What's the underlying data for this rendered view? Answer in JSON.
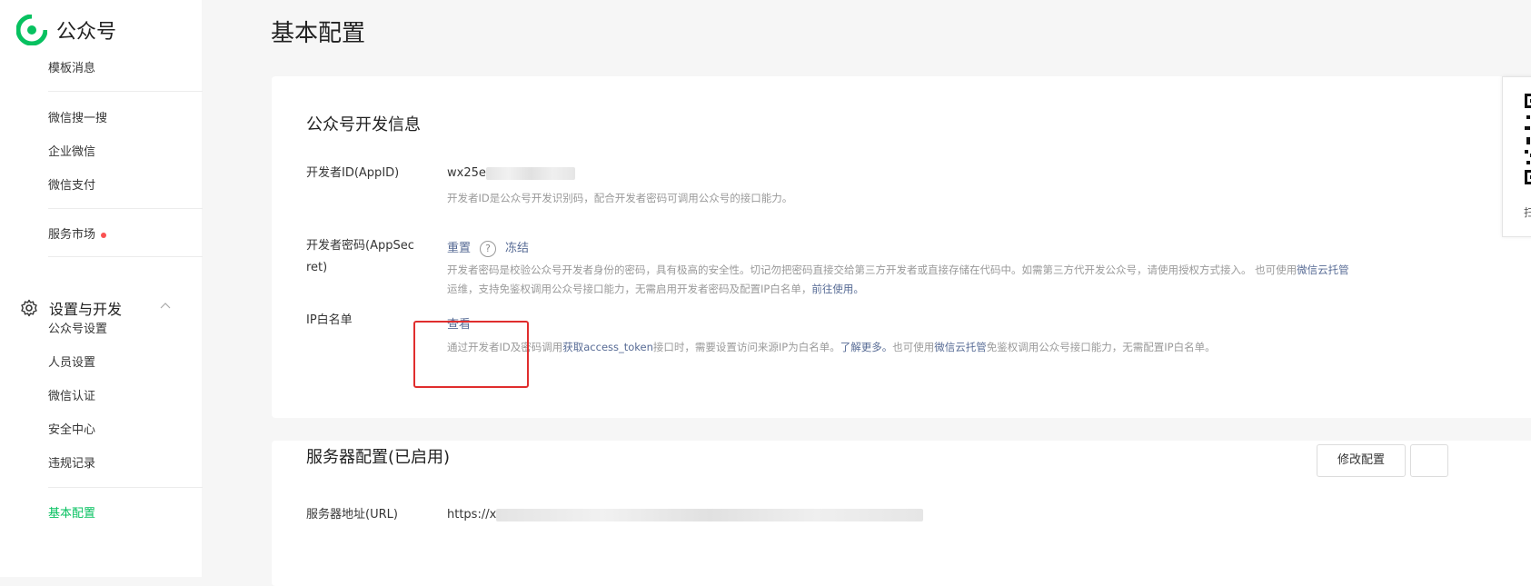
{
  "app": {
    "name": "公众号"
  },
  "sidebar": {
    "items_top": [
      {
        "label": "模板消息"
      },
      {
        "label": "微信搜一搜"
      },
      {
        "label": "企业微信"
      },
      {
        "label": "微信支付"
      },
      {
        "label": "服务市场"
      }
    ],
    "section": {
      "label": "设置与开发"
    },
    "items_settings": [
      {
        "label": "公众号设置"
      },
      {
        "label": "人员设置"
      },
      {
        "label": "微信认证"
      },
      {
        "label": "安全中心"
      },
      {
        "label": "违规记录"
      }
    ],
    "active_item": {
      "label": "基本配置"
    }
  },
  "page": {
    "title": "基本配置"
  },
  "dev_info": {
    "title": "公众号开发信息",
    "appid": {
      "label": "开发者ID(AppID)",
      "value": "wx25e",
      "desc": "开发者ID是公众号开发识别码，配合开发者密码可调用公众号的接口能力。"
    },
    "secret": {
      "label_line1": "开发者密码(AppSec",
      "label_line2": "ret)",
      "reset": "重置",
      "help": "?",
      "freeze": "冻结",
      "desc1": "开发者密码是校验公众号开发者身份的密码，具有极高的安全性。切记勿把密码直接交给第三方开发者或直接存储在代码中。如需第三方代开发公众号，请使用授权方式接入。 也可使用",
      "desc1_link": "微信云托管",
      "desc2": "运维，支持免鉴权调用公众号接口能力，无需启用开发者密码及配置IP白名单，",
      "desc2_link": "前往使用。"
    },
    "ip": {
      "label": "IP白名单",
      "view": "查看",
      "desc_a": "通过开发者ID及密码调用",
      "desc_link1": "获取access_token",
      "desc_b": "接口时，需要设置访问来源IP为白名单。",
      "desc_link2": "了解更多。",
      "desc_c": "也可使用",
      "desc_link3": "微信云托管",
      "desc_d": "免鉴权调用公众号接口能力，无需配置IP白名单。"
    }
  },
  "server": {
    "title": "服务器配置(已启用)",
    "edit_button": "修改配置",
    "url_label": "服务器地址(URL)",
    "url_value": "https://x"
  },
  "qr": {
    "text": "扫"
  },
  "colors": {
    "accent": "#07c160",
    "link": "#576b95",
    "highlight": "#e02d2d"
  }
}
